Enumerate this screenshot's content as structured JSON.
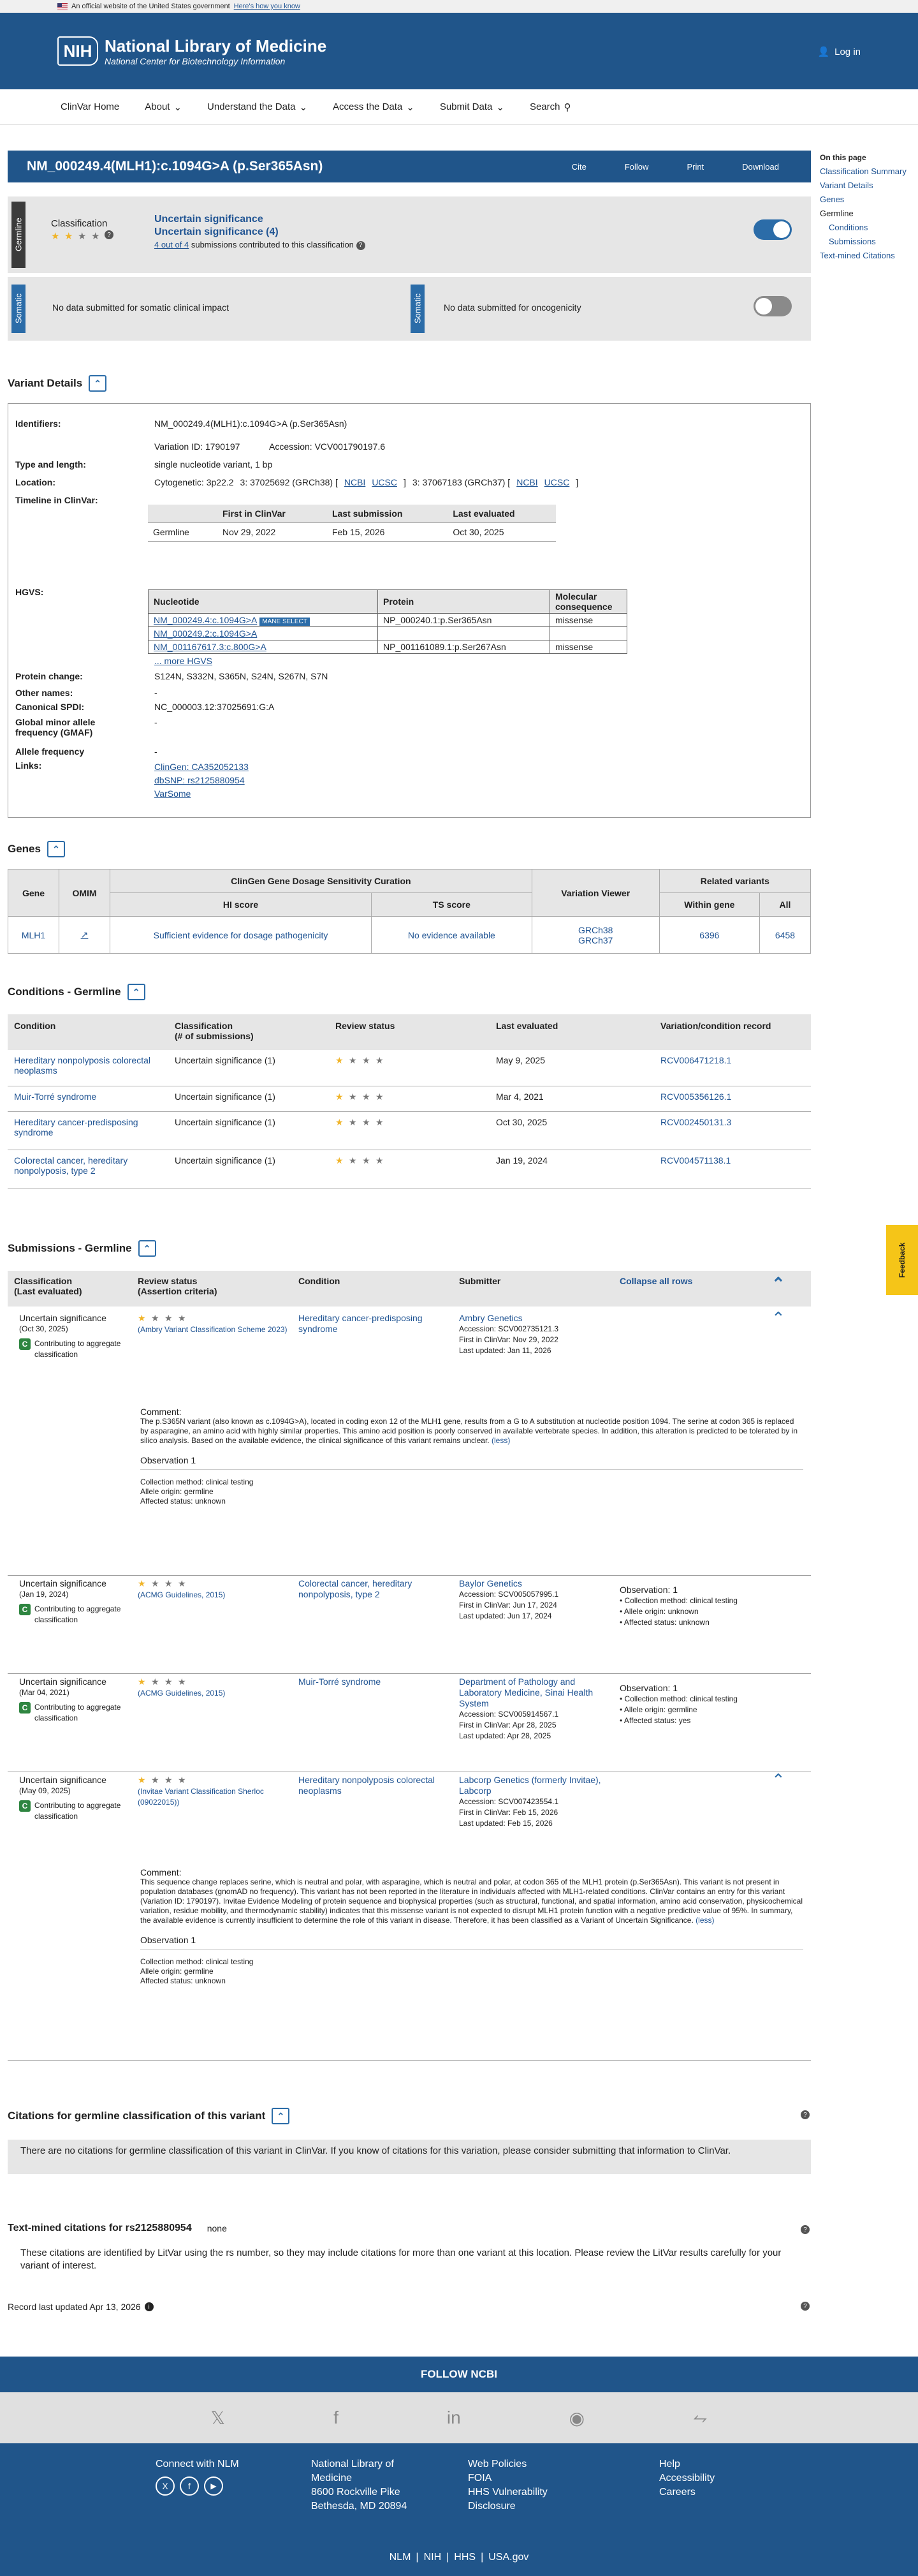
{
  "gov_banner": {
    "text": "An official website of the United States government",
    "link": "Here's how you know"
  },
  "header": {
    "nih": "NIH",
    "title": "National Library of Medicine",
    "subtitle": "National Center for Biotechnology Information",
    "login": "Log in"
  },
  "nav": [
    "ClinVar Home",
    "About",
    "Understand the Data",
    "Access the Data",
    "Submit Data",
    "Search"
  ],
  "title_bar": {
    "title": "NM_000249.4(MLH1):c.1094G>A (p.Ser365Asn)",
    "actions": [
      "Cite",
      "Follow",
      "Print",
      "Download"
    ]
  },
  "on_this_page": {
    "heading": "On this page",
    "items": [
      "Classification Summary",
      "Variant Details",
      "Genes",
      "Germline",
      "Conditions",
      "Submissions",
      "Text-mined Citations"
    ]
  },
  "germline": {
    "tag": "Germline",
    "label": "Classification",
    "cls1": "Uncertain significance",
    "cls2": "Uncertain significance (4)",
    "sub_link": "4 out of 4",
    "sub_rest": "submissions contributed to this classification"
  },
  "somatic": {
    "tag1": "Somatic",
    "text1": "No data submitted for somatic clinical impact",
    "tag2": "Somatic",
    "text2": "No data submitted for oncogenicity"
  },
  "variant_details": {
    "heading": "Variant Details",
    "identifiers_lbl": "Identifiers:",
    "identifiers": "NM_000249.4(MLH1):c.1094G>A (p.Ser365Asn)",
    "variation_id": "Variation ID: 1790197",
    "accession": "Accession: VCV001790197.6",
    "type_lbl": "Type and length:",
    "type": "single nucleotide variant, 1 bp",
    "location_lbl": "Location:",
    "cyto": "Cytogenetic: 3p22.2",
    "grch38": "3: 37025692 (GRCh38) [",
    "ncbi": "NCBI",
    "ucsc": "UCSC",
    "grch37": "3: 37067183 (GRCh37) [",
    "timeline_lbl": "Timeline in ClinVar:",
    "timeline_headers": [
      "First in ClinVar",
      "Last submission",
      "Last evaluated"
    ],
    "timeline_row": [
      "Germline",
      "Nov 29, 2022",
      "Feb 15, 2026",
      "Oct 30, 2025"
    ],
    "hgvs_lbl": "HGVS:",
    "hgvs_headers": [
      "Nucleotide",
      "Protein",
      "Molecular consequence"
    ],
    "hgvs_rows": [
      [
        "NM_000249.4:c.1094G>A",
        "NP_000240.1:p.Ser365Asn",
        "missense"
      ],
      [
        "NM_000249.2:c.1094G>A",
        "",
        ""
      ],
      [
        "NM_001167617.3:c.800G>A",
        "NP_001161089.1:p.Ser267Asn",
        "missense"
      ]
    ],
    "mane": "MANE SELECT",
    "more_hgvs": "... more HGVS",
    "protein_change_lbl": "Protein change:",
    "protein_change": "S124N, S332N, S365N, S24N, S267N, S7N",
    "other_names_lbl": "Other names:",
    "other_names": "-",
    "spdi_lbl": "Canonical SPDI:",
    "spdi": "NC_000003.12:37025691:G:A",
    "gmaf_lbl": "Global minor allele frequency (GMAF)",
    "gmaf": "-",
    "af_lbl": "Allele frequency",
    "af": "-",
    "links_lbl": "Links:",
    "links": [
      "ClinGen: CA352052133",
      "dbSNP: rs2125880954",
      "VarSome"
    ]
  },
  "genes": {
    "heading": "Genes",
    "top_headers": [
      "Gene",
      "OMIM",
      "ClinGen Gene Dosage Sensitivity Curation",
      "Variation Viewer",
      "Related variants"
    ],
    "sub_headers": [
      "HI score",
      "TS score",
      "Within gene",
      "All"
    ],
    "row": {
      "gene": "MLH1",
      "hi": "Sufficient evidence for dosage pathogenicity",
      "ts": "No evidence available",
      "viewer1": "GRCh38",
      "viewer2": "GRCh37",
      "within": "6396",
      "all": "6458"
    }
  },
  "conditions": {
    "heading": "Conditions - Germline",
    "headers": [
      "Condition",
      "Classification\n(# of submissions)",
      "Review status",
      "Last evaluated",
      "Variation/condition record"
    ],
    "rows": [
      [
        "Hereditary nonpolyposis colorectal neoplasms",
        "Uncertain significance (1)",
        "May 9, 2025",
        "RCV006471218.1"
      ],
      [
        "Muir-Torré syndrome",
        "Uncertain significance (1)",
        "Mar 4, 2021",
        "RCV005356126.1"
      ],
      [
        "Hereditary cancer-predisposing syndrome",
        "Uncertain significance (1)",
        "Oct 30, 2025",
        "RCV002450131.3"
      ],
      [
        "Colorectal cancer, hereditary nonpolyposis, type 2",
        "Uncertain significance (1)",
        "Jan 19, 2024",
        "RCV004571138.1"
      ]
    ]
  },
  "submissions": {
    "heading": "Submissions - Germline",
    "headers": {
      "classification": "Classification\n(Last evaluated)",
      "review": "Review status\n(Assertion criteria)",
      "condition": "Condition",
      "submitter": "Submitter",
      "collapse": "Collapse all rows"
    },
    "contributing": "Contributing to aggregate classification",
    "rows": [
      {
        "cls": "Uncertain significance",
        "date": "(Oct 30, 2025)",
        "criteria": "(Ambry Variant Classification Scheme 2023)",
        "condition": "Hereditary cancer-predisposing syndrome",
        "submitter": "Ambry Genetics",
        "acc": "Accession: SCV002735121.3",
        "first": "First in ClinVar: Nov 29, 2022",
        "last": "Last updated: Jan 11, 2026",
        "comment": "The p.S365N variant (also known as c.1094G>A), located in coding exon 12 of the MLH1 gene, results from a G to A substitution at nucleotide position 1094. The serine at codon 365 is replaced by asparagine, an amino acid with highly similar properties. This amino acid position is poorly conserved in available vertebrate species. In addition, this alteration is predicted to be tolerated by in silico analysis. Based on the available evidence, the clinical significance of this variant remains unclear.",
        "less": "(less)",
        "obs": "Observation 1",
        "obs_lines": [
          "Collection method: clinical testing",
          "Allele origin: germline",
          "Affected status: unknown"
        ]
      },
      {
        "cls": "Uncertain significance",
        "date": "(Jan 19, 2024)",
        "criteria": "(ACMG Guidelines, 2015)",
        "condition": "Colorectal cancer, hereditary nonpolyposis, type 2",
        "submitter": "Baylor Genetics",
        "acc": "Accession: SCV005057995.1",
        "first": "First in ClinVar: Jun 17, 2024",
        "last": "Last updated: Jun 17, 2024",
        "obs": "Observation: 1",
        "obs_lines": [
          "Collection method: clinical testing",
          "Allele origin: unknown",
          "Affected status: unknown"
        ]
      },
      {
        "cls": "Uncertain significance",
        "date": "(Mar 04, 2021)",
        "criteria": "(ACMG Guidelines, 2015)",
        "condition": "Muir-Torré syndrome",
        "submitter": "Department of Pathology and Laboratory Medicine, Sinai Health System",
        "acc": "Accession: SCV005914567.1",
        "first": "First in ClinVar: Apr 28, 2025",
        "last": "Last updated: Apr 28, 2025",
        "obs": "Observation: 1",
        "obs_lines": [
          "Collection method: clinical testing",
          "Allele origin: germline",
          "Affected status: yes"
        ]
      },
      {
        "cls": "Uncertain significance",
        "date": "(May 09, 2025)",
        "criteria": "(Invitae Variant Classification Sherloc (09022015))",
        "condition": "Hereditary nonpolyposis colorectal neoplasms",
        "submitter": "Labcorp Genetics (formerly Invitae), Labcorp",
        "acc": "Accession: SCV007423554.1",
        "first": "First in ClinVar: Feb 15, 2026",
        "last": "Last updated: Feb 15, 2026",
        "comment": "This sequence change replaces serine, which is neutral and polar, with asparagine, which is neutral and polar, at codon 365 of the MLH1 protein (p.Ser365Asn). This variant is not present in population databases (gnomAD no frequency). This variant has not been reported in the literature in individuals affected with MLH1-related conditions. ClinVar contains an entry for this variant (Variation ID: 1790197). Invitae Evidence Modeling of protein sequence and biophysical properties (such as structural, functional, and spatial information, amino acid conservation, physicochemical variation, residue mobility, and thermodynamic stability) indicates that this missense variant is not expected to disrupt MLH1 protein function with a negative predictive value of 95%. In summary, the available evidence is currently insufficient to determine the role of this variant in disease. Therefore, it has been classified as a Variant of Uncertain Significance.",
        "less": "(less)",
        "obs": "Observation 1",
        "obs_lines": [
          "Collection method: clinical testing",
          "Allele origin: germline",
          "Affected status: unknown"
        ]
      }
    ],
    "comment_lbl": "Comment:"
  },
  "citations": {
    "heading": "Citations for germline classification of this variant",
    "text": "There are no citations for germline classification of this variant in ClinVar. If you know of citations for this variation, please consider submitting that information to ClinVar."
  },
  "textmined": {
    "heading": "Text-mined citations for rs2125880954",
    "none": "none",
    "text": "These citations are identified by LitVar using the rs number, so they may include citations for more than one variant at this location. Please review the LitVar results carefully for your variant of interest."
  },
  "record": "Record last updated Apr 13, 2026",
  "feedback": "Feedback",
  "footer": {
    "follow": "FOLLOW NCBI",
    "connect": "Connect with NLM",
    "addr": [
      "National Library of",
      "Medicine",
      "8600 Rockville Pike",
      "Bethesda, MD 20894"
    ],
    "policies": [
      "Web Policies",
      "FOIA",
      "HHS Vulnerability",
      "Disclosure"
    ],
    "help": [
      "Help",
      "Accessibility",
      "Careers"
    ],
    "bottom": [
      "NLM",
      "|",
      "NIH",
      "|",
      "HHS",
      "|",
      "USA.gov"
    ]
  }
}
